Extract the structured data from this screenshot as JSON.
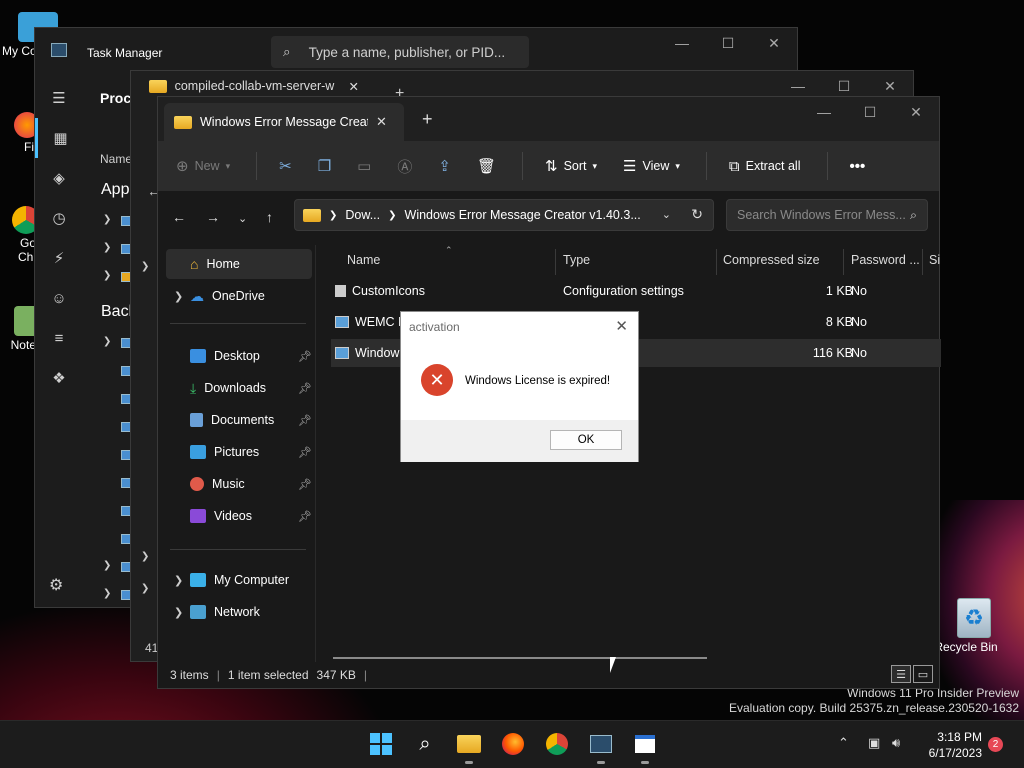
{
  "desktop": {
    "recycle_bin_label": "Recycle Bin",
    "left_icons": [
      "My Co",
      "Fi",
      "Go Chi",
      "Note"
    ]
  },
  "task_manager": {
    "title": "Task Manager",
    "search_placeholder": "Type a name, publisher, or PID...",
    "section_title": "Proce",
    "col_name": "Name",
    "apps_label": "Apps",
    "background_label": "Back"
  },
  "back_explorer": {
    "tab_title": "compiled-collab-vm-server-w",
    "footer": "41"
  },
  "explorer": {
    "tab_title": "Windows Error Message Creat",
    "toolbar": {
      "new": "New",
      "sort": "Sort",
      "view": "View",
      "extract_all": "Extract all"
    },
    "address": {
      "part1": "Dow...",
      "part2": "Windows Error Message Creator v1.40.3..."
    },
    "search_placeholder": "Search Windows Error Mess...",
    "sidebar": {
      "home": "Home",
      "onedrive": "OneDrive",
      "desktop": "Desktop",
      "downloads": "Downloads",
      "documents": "Documents",
      "pictures": "Pictures",
      "music": "Music",
      "videos": "Videos",
      "my_computer": "My Computer",
      "network": "Network"
    },
    "columns": {
      "name": "Name",
      "type": "Type",
      "compressed": "Compressed size",
      "password": "Password ...",
      "size": "Si"
    },
    "rows": [
      {
        "name": "CustomIcons",
        "type": "Configuration settings",
        "compressed": "1 KB",
        "password": "No"
      },
      {
        "name": "WEMC II",
        "type": "",
        "compressed": "8 KB",
        "password": "No"
      },
      {
        "name": "Windows",
        "type": "",
        "compressed": "116 KB",
        "password": "No"
      }
    ],
    "status": {
      "items": "3 items",
      "selected": "1 item selected",
      "size": "347 KB"
    }
  },
  "dialog": {
    "title": "activation",
    "message": "Windows License is expired!",
    "ok": "OK"
  },
  "watermark": {
    "line1": "Windows 11 Pro Insider Preview",
    "line2": "Evaluation copy. Build 25375.zn_release.230520-1632"
  },
  "taskbar": {
    "time": "3:18 PM",
    "date": "6/17/2023",
    "notification_count": "2"
  },
  "colors": {
    "accent": "#4cc2ff",
    "error_icon": "#d9442c",
    "folder": "#f0b93a"
  }
}
